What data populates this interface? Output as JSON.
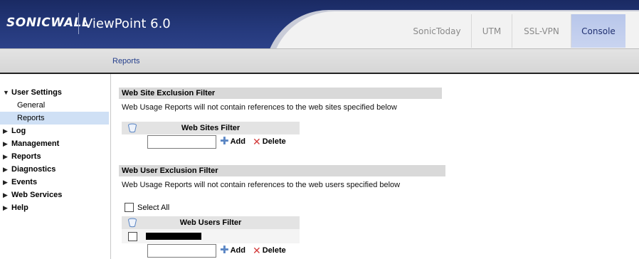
{
  "header": {
    "logo": "SONICWALL",
    "app_title": "ViewPoint 6.0",
    "tabs": [
      {
        "label": "SonicToday",
        "active": false
      },
      {
        "label": "UTM",
        "active": false
      },
      {
        "label": "SSL-VPN",
        "active": false
      },
      {
        "label": "Console",
        "active": true
      }
    ]
  },
  "breadcrumb": "Reports",
  "sidebar": {
    "items": [
      {
        "label": "User Settings",
        "expanded": true,
        "children": [
          {
            "label": "General",
            "selected": false
          },
          {
            "label": "Reports",
            "selected": true
          }
        ]
      },
      {
        "label": "Log",
        "expanded": false
      },
      {
        "label": "Management",
        "expanded": false
      },
      {
        "label": "Reports",
        "expanded": false
      },
      {
        "label": "Diagnostics",
        "expanded": false
      },
      {
        "label": "Events",
        "expanded": false
      },
      {
        "label": "Web Services",
        "expanded": false
      },
      {
        "label": "Help",
        "expanded": false
      }
    ]
  },
  "site_filter": {
    "title": "Web Site Exclusion Filter",
    "description": "Web Usage Reports will not contain references to the web sites specified below",
    "column_header": "Web Sites Filter",
    "input_value": "",
    "add_label": "Add",
    "delete_label": "Delete"
  },
  "user_filter": {
    "title": "Web User Exclusion Filter",
    "description": "Web Usage Reports will not contain references to the web users specified below",
    "select_all_label": "Select All",
    "column_header": "Web Users Filter",
    "input_value": "",
    "add_label": "Add",
    "delete_label": "Delete"
  },
  "colors": {
    "header_bg": "#1a2a63",
    "active_tab": "#c0cdef",
    "section_bar": "#d9d9d9",
    "selected_item": "#cfe0f5"
  }
}
